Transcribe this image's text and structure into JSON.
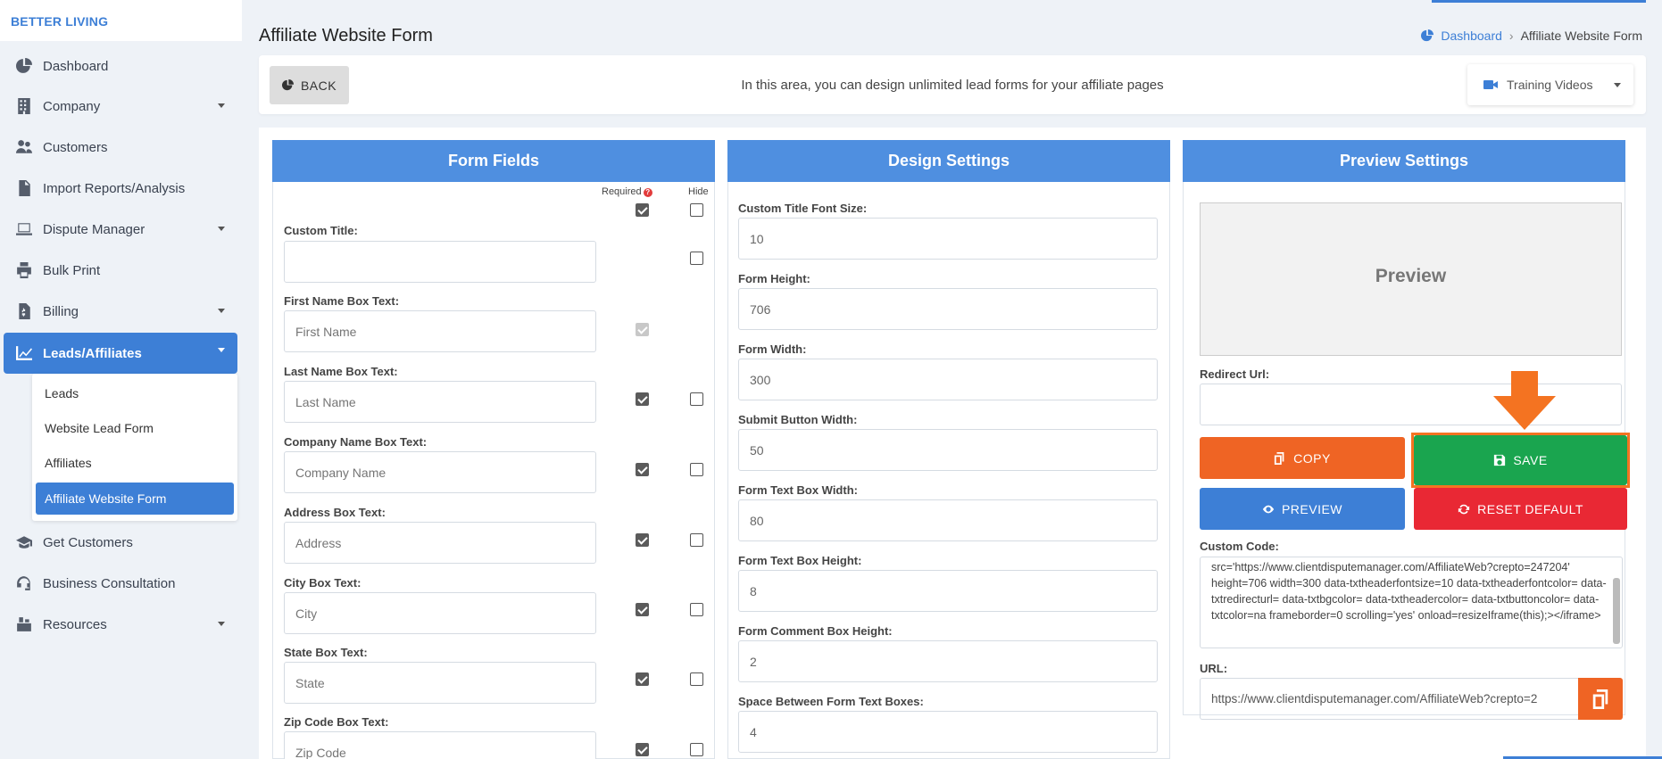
{
  "brand": "BETTER LIVING",
  "sidebar": {
    "items": [
      {
        "label": "Dashboard",
        "icon": "pie-chart-icon"
      },
      {
        "label": "Company",
        "icon": "building-icon"
      },
      {
        "label": "Customers",
        "icon": "users-icon"
      },
      {
        "label": "Import Reports/Analysis",
        "icon": "file-import-icon"
      },
      {
        "label": "Dispute Manager",
        "icon": "laptop-icon"
      },
      {
        "label": "Bulk Print",
        "icon": "printer-icon"
      },
      {
        "label": "Billing",
        "icon": "invoice-icon"
      },
      {
        "label": "Leads/Affiliates",
        "icon": "chart-line-icon"
      },
      {
        "label": "Get Customers",
        "icon": "graduation-cap-icon"
      },
      {
        "label": "Business Consultation",
        "icon": "headset-icon"
      },
      {
        "label": "Resources",
        "icon": "box-icon"
      }
    ],
    "submenu": [
      "Leads",
      "Website Lead Form",
      "Affiliates",
      "Affiliate Website Form"
    ]
  },
  "header": {
    "title": "Affiliate Website Form",
    "breadcrumb_home": "Dashboard",
    "breadcrumb_current": "Affiliate Website Form"
  },
  "topbar": {
    "back_label": "BACK",
    "info_text": "In this area, you can design unlimited lead forms for your affiliate pages",
    "training_label": "Training Videos"
  },
  "form_fields": {
    "title": "Form Fields",
    "required_label": "Required",
    "hide_label": "Hide",
    "fields": [
      {
        "label": "Custom Title:",
        "placeholder": ""
      },
      {
        "label": "First Name Box Text:",
        "placeholder": "First Name"
      },
      {
        "label": "Last Name Box Text:",
        "placeholder": "Last Name"
      },
      {
        "label": "Company Name Box Text:",
        "placeholder": "Company Name"
      },
      {
        "label": "Address Box Text:",
        "placeholder": "Address"
      },
      {
        "label": "City Box Text:",
        "placeholder": "City"
      },
      {
        "label": "State Box Text:",
        "placeholder": "State"
      },
      {
        "label": "Zip Code Box Text:",
        "placeholder": "Zip Code"
      }
    ]
  },
  "design_settings": {
    "title": "Design Settings",
    "fields": [
      {
        "label": "Custom Title Font Size:",
        "value": "10"
      },
      {
        "label": "Form Height:",
        "value": "706"
      },
      {
        "label": "Form Width:",
        "value": "300"
      },
      {
        "label": "Submit Button Width:",
        "value": "50"
      },
      {
        "label": "Form Text Box Width:",
        "value": "80"
      },
      {
        "label": "Form Text Box Height:",
        "value": "8"
      },
      {
        "label": "Form Comment Box Height:",
        "value": "2"
      },
      {
        "label": "Space Between Form Text Boxes:",
        "value": "4"
      }
    ]
  },
  "preview_settings": {
    "title": "Preview Settings",
    "preview_label": "Preview",
    "redirect_label": "Redirect Url:",
    "copy_label": "COPY",
    "save_label": "SAVE",
    "preview_button_label": "PREVIEW",
    "reset_label": "RESET DEFAULT",
    "custom_code_label": "Custom Code:",
    "custom_code": "src='https://www.clientdisputemanager.com/AffiliateWeb?crepto=247204' height=706 width=300 data-txtheaderfontsize=10 data-txtheaderfontcolor= data-txtredirecturl= data-txtbgcolor= data-txtheadercolor= data-txtbuttoncolor= data-txtcolor=na frameborder=0  scrolling='yes' onload=resizeIframe(this);></iframe>",
    "url_label": "URL:",
    "url_value": "https://www.clientdisputemanager.com/AffiliateWeb?crepto=2"
  },
  "colors": {
    "primary": "#3d7fd6",
    "panel_header": "#4f8fe0",
    "copy": "#ef6424",
    "save": "#1aa54f",
    "preview": "#3d7fd6",
    "reset": "#e92834",
    "highlight": "#f47321"
  }
}
